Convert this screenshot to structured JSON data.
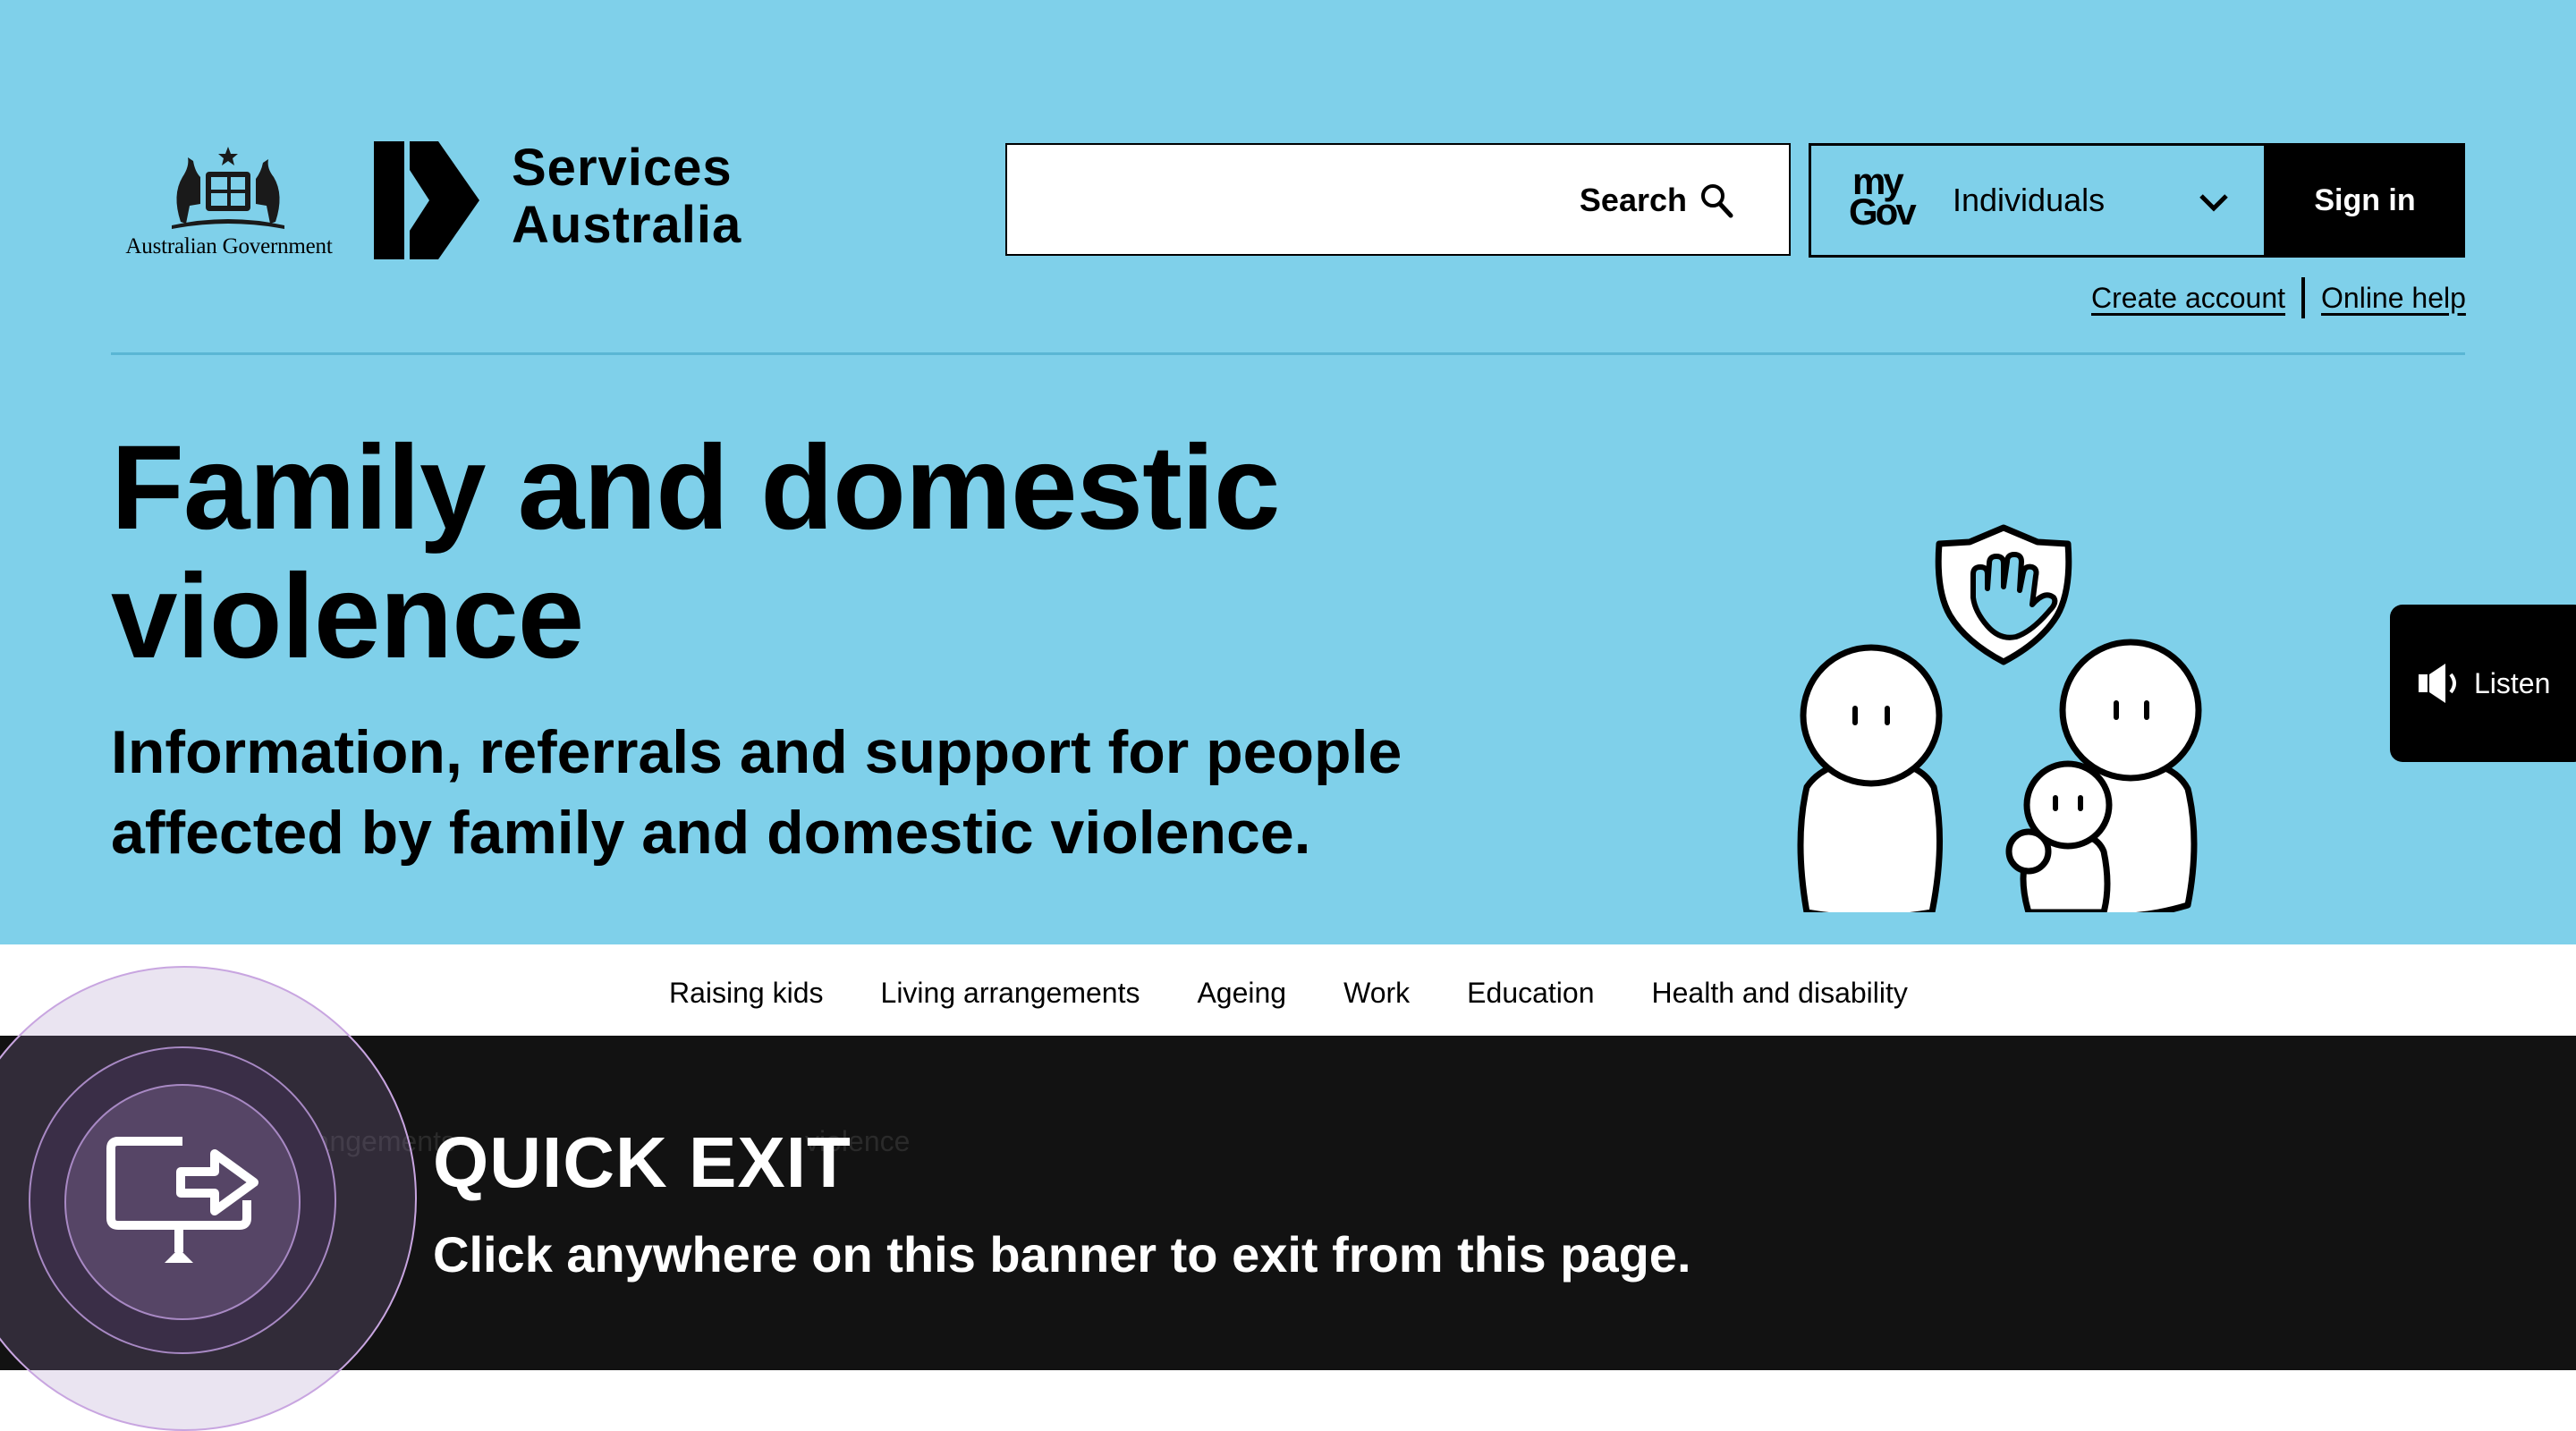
{
  "header": {
    "gov_logo_text": "Australian Government",
    "brand_line1": "Services",
    "brand_line2": "Australia",
    "search_label": "Search",
    "search_placeholder": "",
    "mygov_logo": "myGov",
    "mygov_selected": "Individuals",
    "signin_label": "Sign in",
    "links": [
      "Create account",
      "Online help"
    ]
  },
  "hero": {
    "title": "Family and domestic violence",
    "subtitle": "Information, referrals and support for people affected by family and domestic violence."
  },
  "listen": {
    "label": "Listen"
  },
  "nav": {
    "items": [
      "Raising kids",
      "Living arrangements",
      "Ageing",
      "Work",
      "Education",
      "Health and disability"
    ],
    "active_index": 1
  },
  "quick_exit": {
    "title": "QUICK EXIT",
    "text": "Click anywhere on this banner to exit from this page.",
    "ghost_left": "rangements",
    "ghost_right": "violence"
  },
  "colors": {
    "hero_background": "#7fd0ea",
    "banner_background": "#121212",
    "accent": "#000000"
  }
}
